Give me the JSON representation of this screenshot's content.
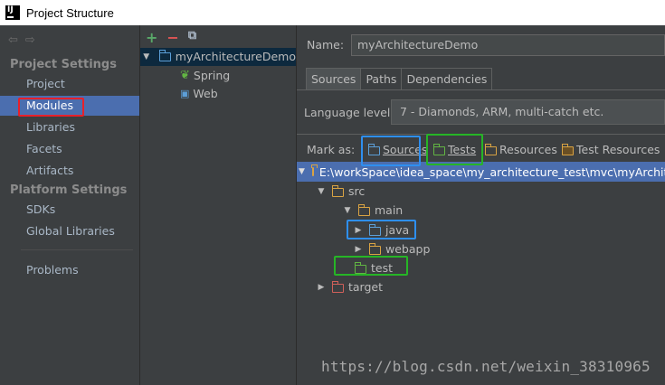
{
  "window": {
    "title": "Project Structure",
    "app_icon_text": "IJ"
  },
  "nav": {
    "back_icon": "arrow-left-icon",
    "forward_icon": "arrow-right-icon"
  },
  "left": {
    "project_settings_title": "Project Settings",
    "project_items": [
      "Project",
      "Modules",
      "Libraries",
      "Facets",
      "Artifacts"
    ],
    "platform_settings_title": "Platform Settings",
    "platform_items": [
      "SDKs",
      "Global Libraries"
    ],
    "problems": "Problems",
    "selected": "Modules"
  },
  "middle": {
    "toolbar": {
      "add": "+",
      "remove": "−",
      "copy": "⧉"
    },
    "module": "myArchitectureDemo",
    "facets": [
      "Spring",
      "Web"
    ]
  },
  "right": {
    "name_label": "Name:",
    "name_value": "myArchitectureDemo",
    "tabs": [
      "Sources",
      "Paths",
      "Dependencies"
    ],
    "active_tab": "Sources",
    "language_label": "Language level:",
    "language_value": "7 - Diamonds, ARM, multi-catch etc.",
    "mark_as_label": "Mark as:",
    "mark_as": [
      "Sources",
      "Tests",
      "Resources",
      "Test Resources"
    ],
    "tree": {
      "root": "E:\\workSpace\\idea_space\\my_architecture_test\\mvc\\myArchitectureDemo",
      "src": "src",
      "main": "main",
      "java": "java",
      "webapp": "webapp",
      "test": "test",
      "target": "target"
    }
  },
  "watermark": "https://blog.csdn.net/weixin_38310965",
  "colors": {
    "background": "#3c3f41",
    "selection": "#4b6eaf",
    "annotation_red": "#e8202a",
    "annotation_blue": "#2e8ff0",
    "annotation_green": "#26b526"
  }
}
